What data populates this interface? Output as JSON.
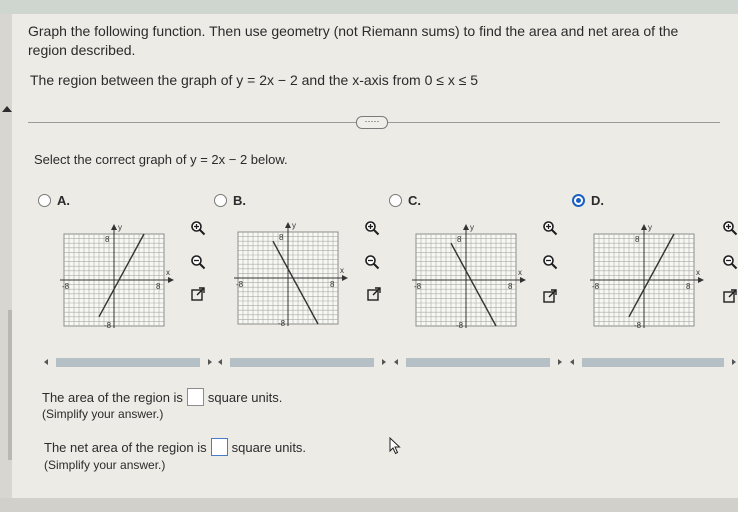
{
  "question": {
    "instruction": "Graph the following function. Then use geometry (not Riemann sums) to find the area and net area of the region described.",
    "region": "The region between the graph of y = 2x − 2 and the x-axis from 0 ≤ x ≤ 5",
    "more_button": "·····"
  },
  "select_prompt": "Select the correct graph of y = 2x − 2 below.",
  "options": [
    {
      "label": "A.",
      "selected": false,
      "slope_sign": "positive",
      "x_intercept": 1
    },
    {
      "label": "B.",
      "selected": false,
      "slope_sign": "negative",
      "x_intercept": 1
    },
    {
      "label": "C.",
      "selected": false,
      "slope_sign": "negative",
      "x_intercept": 1
    },
    {
      "label": "D.",
      "selected": true,
      "slope_sign": "positive",
      "x_intercept": 1
    }
  ],
  "graph_labels": {
    "y": "y",
    "x": "x",
    "pos": "8",
    "neg": "-8"
  },
  "tools": [
    "zoom-in-icon",
    "zoom-out-icon",
    "popout-icon"
  ],
  "area": {
    "prefix": "The area of the region is",
    "suffix": "square units.",
    "hint": "(Simplify your answer.)"
  },
  "net_area": {
    "prefix": "The net area of the region is",
    "suffix": "square units.",
    "hint": "(Simplify your answer.)"
  },
  "colors": {
    "accent": "#1b5fc1",
    "grid": "#8c8c8c",
    "line": "#333333"
  }
}
